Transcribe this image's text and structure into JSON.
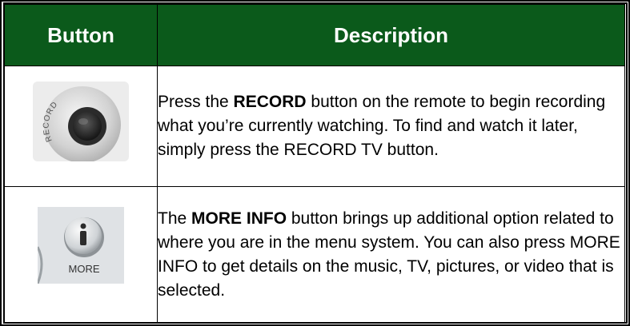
{
  "table": {
    "headers": {
      "button": "Button",
      "description": "Description"
    },
    "rows": [
      {
        "icon": "record-button-icon",
        "icon_text": "RECORD",
        "desc_pre": "Press the ",
        "desc_key": "RECORD",
        "desc_post": " button on the remote to begin recording what you’re currently watching. To find and watch it later, simply press the RECORD TV button."
      },
      {
        "icon": "more-info-button-icon",
        "icon_text": "MORE",
        "desc_pre": "The ",
        "desc_key": "MORE INFO",
        "desc_post": " button brings up additional option related to where you are in the menu system. You can also press MORE INFO to get details on the music, TV, pictures, or video that is selected."
      }
    ]
  },
  "colors": {
    "header_bg": "#0b5a1b",
    "header_text": "#ffffff"
  }
}
